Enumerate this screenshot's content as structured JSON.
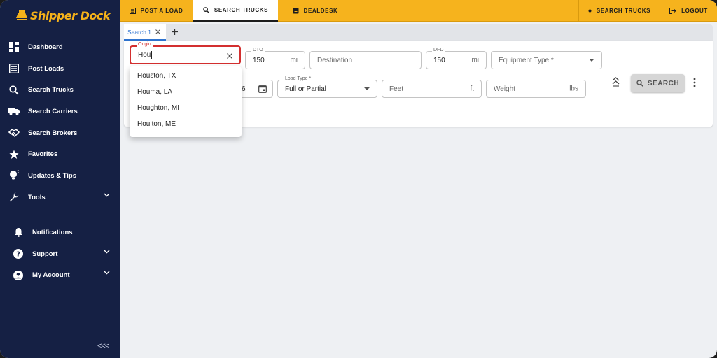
{
  "brand": {
    "name": "Shipper Dock",
    "accent": "#f6b31d",
    "sidebar_bg": "#152044"
  },
  "sidebar": {
    "items": [
      {
        "label": "Dashboard",
        "icon": "dashboard-icon"
      },
      {
        "label": "Post Loads",
        "icon": "list-icon"
      },
      {
        "label": "Search Trucks",
        "icon": "search-icon"
      },
      {
        "label": "Search Carriers",
        "icon": "truck-icon"
      },
      {
        "label": "Search Brokers",
        "icon": "handshake-icon"
      },
      {
        "label": "Favorites",
        "icon": "star-icon"
      },
      {
        "label": "Updates & Tips",
        "icon": "lightbulb-icon"
      },
      {
        "label": "Tools",
        "icon": "wrench-icon"
      }
    ],
    "bottom_items": [
      {
        "label": "Notifications",
        "icon": "bell-icon"
      },
      {
        "label": "Support",
        "icon": "help-icon"
      },
      {
        "label": "My Account",
        "icon": "account-icon"
      }
    ],
    "collapse_label": "<<<"
  },
  "topbar": {
    "tabs": [
      {
        "label": "POST A LOAD",
        "icon": "list-icon"
      },
      {
        "label": "SEARCH TRUCKS",
        "icon": "search-icon"
      },
      {
        "label": "DEALDESK",
        "icon": "dealdesk-icon"
      }
    ],
    "right": [
      {
        "label": "SEARCH TRUCKS",
        "icon": "dot-icon"
      },
      {
        "label": "LOGOUT",
        "icon": "logout-icon"
      }
    ]
  },
  "search": {
    "tab_label": "Search 1",
    "origin": {
      "label": "Origin",
      "value": "Hou"
    },
    "dto": {
      "label": "DTO",
      "value": "150",
      "unit": "mi"
    },
    "destination": {
      "placeholder": "Destination"
    },
    "dfd": {
      "label": "DFD",
      "value": "150",
      "unit": "mi"
    },
    "equipment": {
      "placeholder": "Equipment Type *"
    },
    "date_fragment": "6",
    "load_type": {
      "label": "Load Type *",
      "value": "Full or Partial"
    },
    "feet": {
      "placeholder": "Feet",
      "unit": "ft"
    },
    "weight": {
      "placeholder": "Weight",
      "unit": "lbs"
    },
    "search_button": "SEARCH",
    "suggestions": [
      "Houston, TX",
      "Houma, LA",
      "Houghton, MI",
      "Houlton, ME"
    ]
  }
}
